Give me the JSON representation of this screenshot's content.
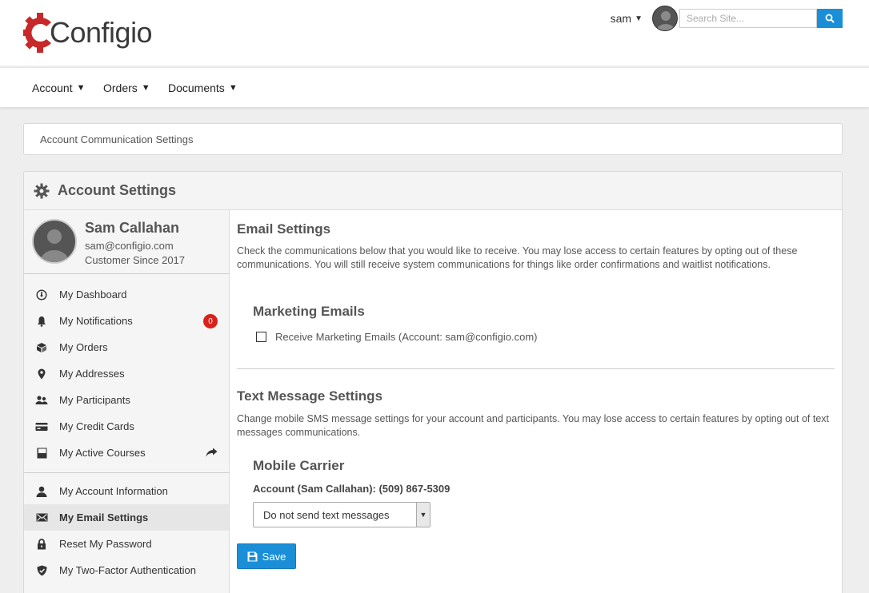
{
  "brand": {
    "name": "Configio",
    "accent_color": "#c7292a"
  },
  "header": {
    "user": {
      "name": "sam"
    },
    "search": {
      "placeholder": "Search Site..."
    }
  },
  "nav": {
    "items": [
      {
        "label": "Account"
      },
      {
        "label": "Orders"
      },
      {
        "label": "Documents"
      }
    ]
  },
  "breadcrumb": {
    "text": "Account Communication Settings"
  },
  "panel": {
    "title": "Account Settings"
  },
  "profile": {
    "name": "Sam Callahan",
    "email": "sam@configio.com",
    "since": "Customer Since 2017"
  },
  "sidebar": {
    "items": [
      {
        "label": "My Dashboard",
        "icon": "dashboard-icon"
      },
      {
        "label": "My Notifications",
        "icon": "bell-icon",
        "badge": "0"
      },
      {
        "label": "My Orders",
        "icon": "box-icon"
      },
      {
        "label": "My Addresses",
        "icon": "map-pin-icon"
      },
      {
        "label": "My Participants",
        "icon": "users-icon"
      },
      {
        "label": "My Credit Cards",
        "icon": "credit-card-icon"
      },
      {
        "label": "My Active Courses",
        "icon": "book-icon"
      }
    ],
    "account_items": [
      {
        "label": "My Account Information",
        "icon": "user-icon"
      },
      {
        "label": "My Email Settings",
        "icon": "envelope-icon",
        "active": true
      },
      {
        "label": "Reset My Password",
        "icon": "lock-icon"
      },
      {
        "label": "My Two-Factor Authentication",
        "icon": "shield-icon"
      }
    ]
  },
  "email_settings": {
    "heading": "Email Settings",
    "description": "Check the communications below that you would like to receive. You may lose access to certain features by opting out of these communications. You will still receive system communications for things like order confirmations and waitlist notifications.",
    "marketing_heading": "Marketing Emails",
    "marketing_checkbox_label": "Receive Marketing Emails (Account: sam@configio.com)",
    "marketing_checked": false
  },
  "text_settings": {
    "heading": "Text Message Settings",
    "description": "Change mobile SMS message settings for your account and participants. You may lose access to certain features by opting out of text messages communications.",
    "carrier_heading": "Mobile Carrier",
    "account_label": "Account (Sam Callahan): (509) 867-5309",
    "carrier_selected": "Do not send text messages"
  },
  "actions": {
    "save_label": "Save"
  }
}
